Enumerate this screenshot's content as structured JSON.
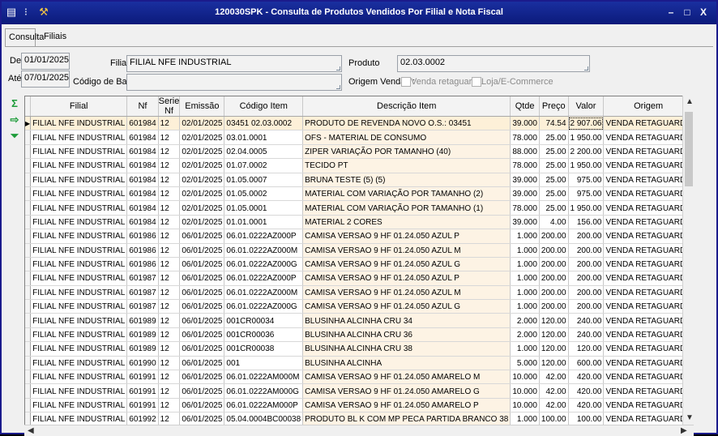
{
  "window": {
    "title": "120030SPK - Consulta de Produtos Vendidos Por Filial e Nota Fiscal",
    "buttons": [
      "–",
      "□",
      "X"
    ]
  },
  "tabs": [
    {
      "label": "Consulta"
    },
    {
      "label": "Filiais"
    }
  ],
  "filters": {
    "de_label": "De",
    "de_value": "01/01/2025",
    "ate_label": "Até",
    "ate_value": "07/01/2025",
    "filial_label": "Filial",
    "filial_value": "FILIAL NFE INDUSTRIAL",
    "codigo_barras_label": "Código de Barras",
    "codigo_barras_value": "",
    "produto_label": "Produto",
    "produto_value": "02.03.0002",
    "origem_label": "Origem Vendas :",
    "origem_retaguarda": "Venda retaguarda",
    "origem_ecommerce": "Loja/E-Commerce"
  },
  "side_icons": [
    "sum-icon",
    "export-icon",
    "filter-down-icon"
  ],
  "grid": {
    "columns": [
      "Filial",
      "Nf",
      "Serie Nf",
      "Emissão",
      "Código Item",
      "Descrição Item",
      "Qtde",
      "Preço",
      "Valor",
      "Origem"
    ],
    "rows": [
      [
        "FILIAL NFE INDUSTRIAL",
        "601984",
        "12",
        "02/01/2025",
        "03451 02.03.0002",
        "PRODUTO DE REVENDA NOVO O.S.: 03451",
        "39.000",
        "74.54",
        "2 907.06",
        "VENDA RETAGUARDA"
      ],
      [
        "FILIAL NFE INDUSTRIAL",
        "601984",
        "12",
        "02/01/2025",
        "03.01.0001",
        "OFS - MATERIAL DE CONSUMO",
        "78.000",
        "25.00",
        "1 950.00",
        "VENDA RETAGUARDA"
      ],
      [
        "FILIAL NFE INDUSTRIAL",
        "601984",
        "12",
        "02/01/2025",
        "02.04.0005",
        "ZIPER VARIAÇÃO POR TAMANHO (40)",
        "88.000",
        "25.00",
        "2 200.00",
        "VENDA RETAGUARDA"
      ],
      [
        "FILIAL NFE INDUSTRIAL",
        "601984",
        "12",
        "02/01/2025",
        "01.07.0002",
        "TECIDO PT",
        "78.000",
        "25.00",
        "1 950.00",
        "VENDA RETAGUARDA"
      ],
      [
        "FILIAL NFE INDUSTRIAL",
        "601984",
        "12",
        "02/01/2025",
        "01.05.0007",
        "BRUNA TESTE (5) (5)",
        "39.000",
        "25.00",
        "975.00",
        "VENDA RETAGUARDA"
      ],
      [
        "FILIAL NFE INDUSTRIAL",
        "601984",
        "12",
        "02/01/2025",
        "01.05.0002",
        "MATERIAL COM VARIAÇÃO POR TAMANHO (2)",
        "39.000",
        "25.00",
        "975.00",
        "VENDA RETAGUARDA"
      ],
      [
        "FILIAL NFE INDUSTRIAL",
        "601984",
        "12",
        "02/01/2025",
        "01.05.0001",
        "MATERIAL COM VARIAÇÃO POR TAMANHO (1)",
        "78.000",
        "25.00",
        "1 950.00",
        "VENDA RETAGUARDA"
      ],
      [
        "FILIAL NFE INDUSTRIAL",
        "601984",
        "12",
        "02/01/2025",
        "01.01.0001",
        "MATERIAL 2 CORES",
        "39.000",
        "4.00",
        "156.00",
        "VENDA RETAGUARDA"
      ],
      [
        "FILIAL NFE INDUSTRIAL",
        "601986",
        "12",
        "06/01/2025",
        "06.01.0222AZ000P",
        "CAMISA VERSAO 9  HF 01.24.050 AZUL P",
        "1.000",
        "200.00",
        "200.00",
        "VENDA RETAGUARDA"
      ],
      [
        "FILIAL NFE INDUSTRIAL",
        "601986",
        "12",
        "06/01/2025",
        "06.01.0222AZ000M",
        "CAMISA VERSAO 9  HF 01.24.050 AZUL M",
        "1.000",
        "200.00",
        "200.00",
        "VENDA RETAGUARDA"
      ],
      [
        "FILIAL NFE INDUSTRIAL",
        "601986",
        "12",
        "06/01/2025",
        "06.01.0222AZ000G",
        "CAMISA VERSAO 9  HF 01.24.050 AZUL G",
        "1.000",
        "200.00",
        "200.00",
        "VENDA RETAGUARDA"
      ],
      [
        "FILIAL NFE INDUSTRIAL",
        "601987",
        "12",
        "06/01/2025",
        "06.01.0222AZ000P",
        "CAMISA VERSAO 9  HF 01.24.050 AZUL P",
        "1.000",
        "200.00",
        "200.00",
        "VENDA RETAGUARDA"
      ],
      [
        "FILIAL NFE INDUSTRIAL",
        "601987",
        "12",
        "06/01/2025",
        "06.01.0222AZ000M",
        "CAMISA VERSAO 9  HF 01.24.050 AZUL M",
        "1.000",
        "200.00",
        "200.00",
        "VENDA RETAGUARDA"
      ],
      [
        "FILIAL NFE INDUSTRIAL",
        "601987",
        "12",
        "06/01/2025",
        "06.01.0222AZ000G",
        "CAMISA VERSAO 9  HF 01.24.050 AZUL G",
        "1.000",
        "200.00",
        "200.00",
        "VENDA RETAGUARDA"
      ],
      [
        "FILIAL NFE INDUSTRIAL",
        "601989",
        "12",
        "06/01/2025",
        "001CR00034",
        "BLUSINHA ALCINHA CRU 34",
        "2.000",
        "120.00",
        "240.00",
        "VENDA RETAGUARDA"
      ],
      [
        "FILIAL NFE INDUSTRIAL",
        "601989",
        "12",
        "06/01/2025",
        "001CR00036",
        "BLUSINHA ALCINHA CRU 36",
        "2.000",
        "120.00",
        "240.00",
        "VENDA RETAGUARDA"
      ],
      [
        "FILIAL NFE INDUSTRIAL",
        "601989",
        "12",
        "06/01/2025",
        "001CR00038",
        "BLUSINHA ALCINHA CRU 38",
        "1.000",
        "120.00",
        "120.00",
        "VENDA RETAGUARDA"
      ],
      [
        "FILIAL NFE INDUSTRIAL",
        "601990",
        "12",
        "06/01/2025",
        "001",
        "BLUSINHA ALCINHA",
        "5.000",
        "120.00",
        "600.00",
        "VENDA RETAGUARDA"
      ],
      [
        "FILIAL NFE INDUSTRIAL",
        "601991",
        "12",
        "06/01/2025",
        "06.01.0222AM000M",
        "CAMISA VERSAO 9  HF 01.24.050 AMARELO M",
        "10.000",
        "42.00",
        "420.00",
        "VENDA RETAGUARDA"
      ],
      [
        "FILIAL NFE INDUSTRIAL",
        "601991",
        "12",
        "06/01/2025",
        "06.01.0222AM000G",
        "CAMISA VERSAO 9  HF 01.24.050 AMARELO G",
        "10.000",
        "42.00",
        "420.00",
        "VENDA RETAGUARDA"
      ],
      [
        "FILIAL NFE INDUSTRIAL",
        "601991",
        "12",
        "06/01/2025",
        "06.01.0222AM000P",
        "CAMISA VERSAO 9  HF 01.24.050 AMARELO P",
        "10.000",
        "42.00",
        "420.00",
        "VENDA RETAGUARDA"
      ],
      [
        "FILIAL NFE INDUSTRIAL",
        "601992",
        "12",
        "06/01/2025",
        "05.04.0004BC00038",
        "PRODUTO BL K COM MP PECA PARTIDA BRANCO 38",
        "1.000",
        "100.00",
        "100.00",
        "VENDA RETAGUARDA"
      ]
    ]
  },
  "colors": {
    "titlebar": "#0b1a7a",
    "selected_row": "#fdf0d8",
    "desc_column": "#fdf3e4"
  }
}
